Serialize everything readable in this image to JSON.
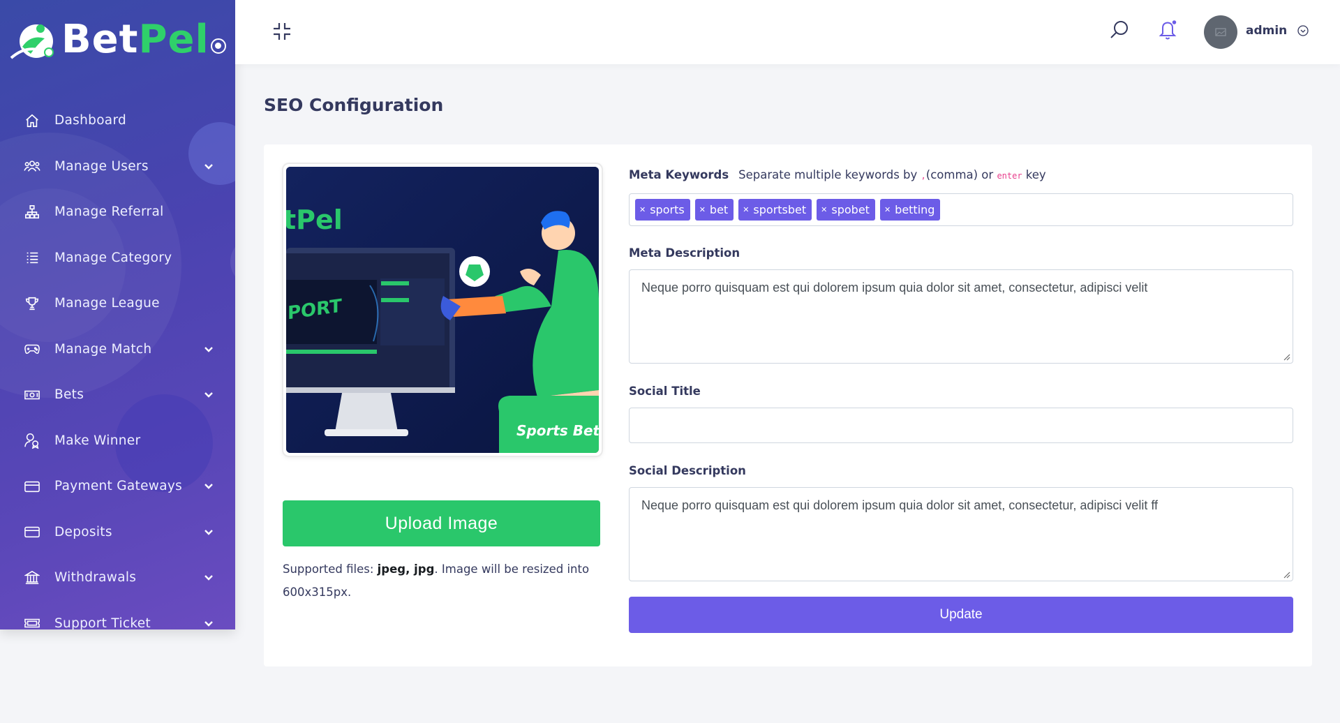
{
  "brand": {
    "part1": "Bet",
    "part2": "Pel"
  },
  "sidebar": {
    "items": [
      {
        "label": "Dashboard",
        "icon": "home-icon",
        "has_submenu": false
      },
      {
        "label": "Manage Users",
        "icon": "users-icon",
        "has_submenu": true
      },
      {
        "label": "Manage Referral",
        "icon": "sitemap-icon",
        "has_submenu": false
      },
      {
        "label": "Manage Category",
        "icon": "list-icon",
        "has_submenu": false
      },
      {
        "label": "Manage League",
        "icon": "trophy-icon",
        "has_submenu": false
      },
      {
        "label": "Manage Match",
        "icon": "gamepad-icon",
        "has_submenu": true
      },
      {
        "label": "Bets",
        "icon": "money-bill-icon",
        "has_submenu": true
      },
      {
        "label": "Make Winner",
        "icon": "user-award-icon",
        "has_submenu": false
      },
      {
        "label": "Payment Gateways",
        "icon": "credit-card-icon",
        "has_submenu": true
      },
      {
        "label": "Deposits",
        "icon": "wallet-icon",
        "has_submenu": true
      },
      {
        "label": "Withdrawals",
        "icon": "bank-icon",
        "has_submenu": true
      },
      {
        "label": "Support Ticket",
        "icon": "ticket-icon",
        "has_submenu": true
      }
    ]
  },
  "header": {
    "user_name": "admin"
  },
  "page": {
    "title": "SEO Configuration"
  },
  "preview": {
    "brand_fragment": "tPel",
    "screen_word": "PORT",
    "ribbon": "Sports Bet"
  },
  "upload": {
    "button_label": "Upload Image",
    "supported_prefix": "Supported files: ",
    "supported_types": "jpeg, jpg",
    "supported_suffix": ". Image will be resized into 600x315px."
  },
  "form": {
    "meta_keywords": {
      "label": "Meta Keywords",
      "hint_prefix": "Separate multiple keywords by ",
      "hint_comma": ",",
      "hint_mid": "(comma) or ",
      "hint_key": "enter",
      "hint_suffix": " key",
      "tags": [
        "sports",
        "bet",
        "sportsbet",
        "spobet",
        "betting"
      ]
    },
    "meta_description": {
      "label": "Meta Description",
      "value": "Neque porro quisquam est qui dolorem ipsum quia dolor sit amet, consectetur, adipisci velit"
    },
    "social_title": {
      "label": "Social Title",
      "value": ""
    },
    "social_description": {
      "label": "Social Description",
      "value": "Neque porro quisquam est qui dolorem ipsum quia dolor sit amet, consectetur, adipisci velit ff"
    },
    "update_label": "Update"
  },
  "colors": {
    "primary": "#6c5ce7",
    "success": "#2ac76b",
    "sidebar_start": "#3a4aa8",
    "sidebar_end": "#6a4cc0",
    "brand_green": "#2fd06a"
  }
}
